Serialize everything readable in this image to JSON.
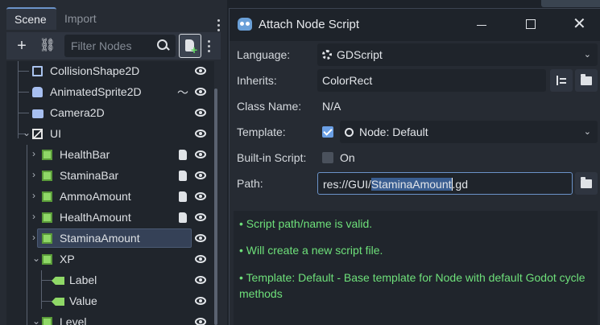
{
  "scene_panel": {
    "tabs": [
      {
        "label": "Scene"
      },
      {
        "label": "Import"
      }
    ],
    "filter_placeholder": "Filter Nodes",
    "tree": [
      {
        "label": "CollisionShape2D"
      },
      {
        "label": "AnimatedSprite2D"
      },
      {
        "label": "Camera2D"
      },
      {
        "label": "UI"
      },
      {
        "label": "HealthBar"
      },
      {
        "label": "StaminaBar"
      },
      {
        "label": "AmmoAmount"
      },
      {
        "label": "HealthAmount"
      },
      {
        "label": "StaminaAmount"
      },
      {
        "label": "XP"
      },
      {
        "label": "Label"
      },
      {
        "label": "Value"
      },
      {
        "label": "Level"
      }
    ]
  },
  "dialog": {
    "title": "Attach Node Script",
    "language": {
      "label": "Language:",
      "value": "GDScript"
    },
    "inherits": {
      "label": "Inherits:",
      "value": "ColorRect"
    },
    "class_name": {
      "label": "Class Name:",
      "value": "N/A"
    },
    "template": {
      "label": "Template:",
      "value": "Node: Default"
    },
    "builtin": {
      "label": "Built-in Script:",
      "value": "On"
    },
    "path": {
      "label": "Path:",
      "prefix": "res://GUI/",
      "selected": "StaminaAmount",
      "suffix": ".gd"
    },
    "messages": [
      "•  Script path/name is valid.",
      "•  Will create a new script file.",
      "•  Template: Default - Base template for Node with default Godot cycle methods"
    ]
  }
}
